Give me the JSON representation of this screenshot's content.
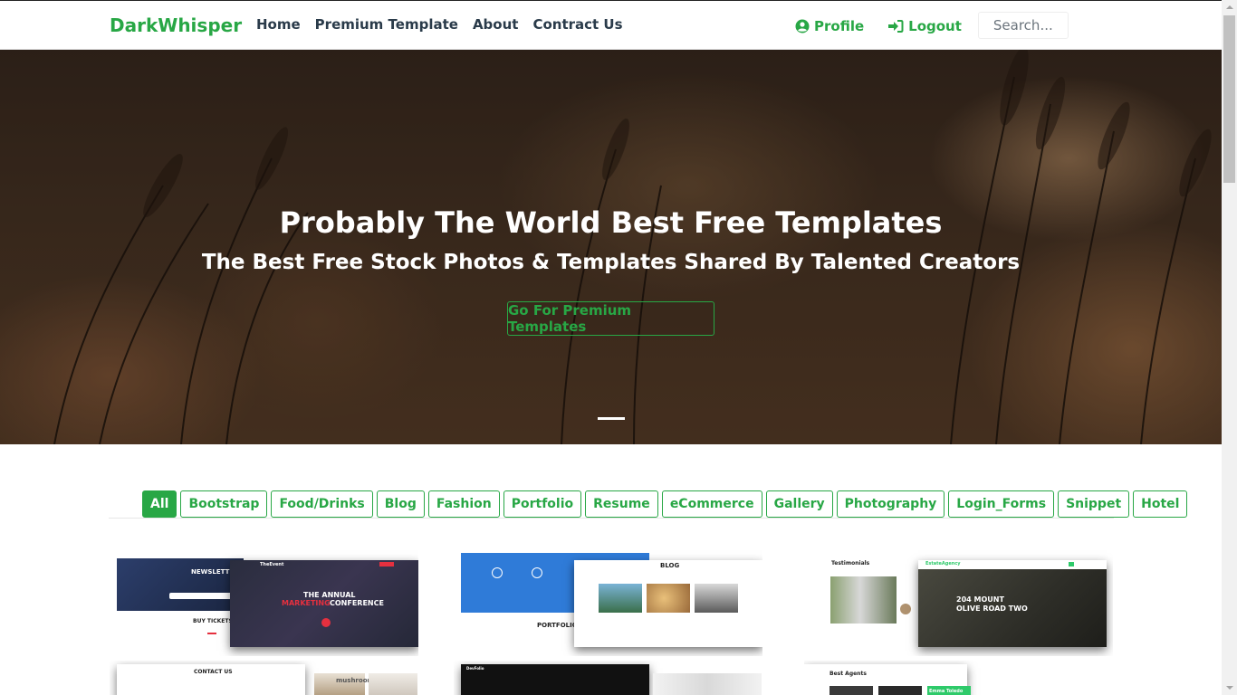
{
  "nav": {
    "brand": "DarkWhisper",
    "links": [
      "Home",
      "Premium Template",
      "About",
      "Contract Us"
    ],
    "profile": "Profile",
    "logout": "Logout",
    "search_placeholder": "Search...."
  },
  "hero": {
    "title": "Probably The World Best Free Templates",
    "subtitle": "The Best Free Stock Photos & Templates Shared By Talented Creators",
    "button": "Go For Premium Templates"
  },
  "filters": {
    "active": "All",
    "items": [
      "All",
      "Bootstrap",
      "Food/Drinks",
      "Blog",
      "Fashion",
      "Portfolio",
      "Resume",
      "eCommerce",
      "Gallery",
      "Photography",
      "Login_Forms",
      "Snippet",
      "Hotel"
    ]
  },
  "templates": {
    "t1": {
      "newsletter": "NEWSLETTER",
      "brand": "TheEvent",
      "line1": "THE ANNUAL",
      "line2": "MARKETING",
      "line3": "CONFERENCE",
      "tickets": "BUY TICKETS"
    },
    "t2": {
      "blog": "BLOG",
      "portfolio": "PORTFOLIO"
    },
    "t3": {
      "testimonials": "Testimonials",
      "brand": "EstateAgency",
      "line1": "204 MOUNT",
      "line2": "OLIVE ROAD TWO"
    },
    "t4": {
      "contact": "CONTACT US",
      "word": "mushroom"
    },
    "t5": {
      "brand": "DevFolio"
    },
    "t6": {
      "agents": "Best Agents",
      "name": "Emma Toledo"
    }
  },
  "colors": {
    "accent": "#28a745",
    "nav_text": "#2a3b4a"
  }
}
